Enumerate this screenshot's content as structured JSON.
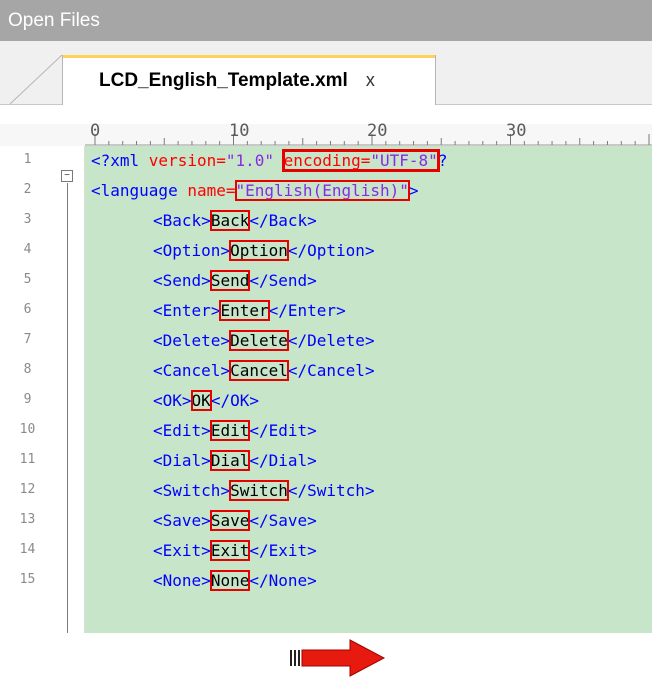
{
  "window": {
    "title": "Open Files"
  },
  "tab": {
    "label": "LCD_English_Template.xml",
    "close": "x"
  },
  "ruler": {
    "marks": [
      "0",
      "10",
      "20",
      "30"
    ]
  },
  "editor": {
    "line_numbers": [
      "1",
      "2",
      "3",
      "4",
      "5",
      "6",
      "7",
      "8",
      "9",
      "10",
      "11",
      "12",
      "13",
      "14",
      "15"
    ],
    "lines": [
      {
        "type": "decl",
        "lt": "<?xml ",
        "a1": "version=",
        "v1": "\"1.0\"",
        "sp": " ",
        "a2": "encoding=",
        "v2": "\"UTF-8\"",
        "q": "?"
      },
      {
        "type": "lang",
        "lt": "<language ",
        "a1": "name=",
        "v1": "\"English(English)\"",
        "gt": ">"
      },
      {
        "type": "elem",
        "tag": "Back",
        "value": "Back"
      },
      {
        "type": "elem",
        "tag": "Option",
        "value": "Option"
      },
      {
        "type": "elem",
        "tag": "Send",
        "value": "Send"
      },
      {
        "type": "elem",
        "tag": "Enter",
        "value": "Enter"
      },
      {
        "type": "elem",
        "tag": "Delete",
        "value": "Delete"
      },
      {
        "type": "elem",
        "tag": "Cancel",
        "value": "Cancel"
      },
      {
        "type": "elem",
        "tag": "OK",
        "value": "OK"
      },
      {
        "type": "elem",
        "tag": "Edit",
        "value": "Edit"
      },
      {
        "type": "elem",
        "tag": "Dial",
        "value": "Dial"
      },
      {
        "type": "elem",
        "tag": "Switch",
        "value": "Switch"
      },
      {
        "type": "elem",
        "tag": "Save",
        "value": "Save"
      },
      {
        "type": "elem",
        "tag": "Exit",
        "value": "Exit"
      },
      {
        "type": "elem",
        "tag": "None",
        "value": "None"
      }
    ]
  },
  "colors": {
    "titlebar": "#a6a6a6",
    "editor_bg": "#c6e5c9",
    "tag": "#0000ff",
    "attr": "#ff0000",
    "value": "#8a2be2",
    "highlight_box": "#e60000",
    "tab_accent": "#ffd35b"
  },
  "icons": {
    "fold": "minus-box-icon",
    "arrow": "right-arrow-icon"
  }
}
